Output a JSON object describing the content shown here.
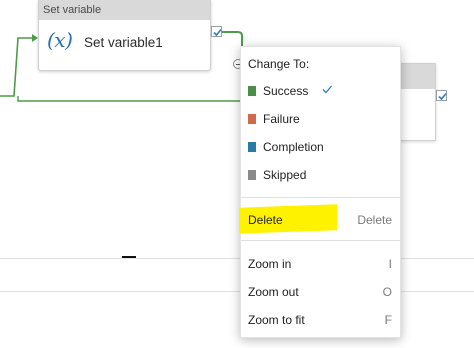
{
  "activity": {
    "type_label": "Set variable",
    "icon": "(x)",
    "name": "Set variable1"
  },
  "context_menu": {
    "title": "Change To:",
    "status_options": [
      {
        "label": "Success",
        "color": "#4e8c4a",
        "selected": true
      },
      {
        "label": "Failure",
        "color": "#d06a4c",
        "selected": false
      },
      {
        "label": "Completion",
        "color": "#2a7aa6",
        "selected": false
      },
      {
        "label": "Skipped",
        "color": "#8a8a8a",
        "selected": false
      }
    ],
    "delete": {
      "label": "Delete",
      "shortcut": "Delete",
      "highlight_color": "#fff200"
    },
    "zoom_actions": [
      {
        "label": "Zoom in",
        "shortcut": "I"
      },
      {
        "label": "Zoom out",
        "shortcut": "O"
      },
      {
        "label": "Zoom to fit",
        "shortcut": "F"
      }
    ]
  },
  "colors": {
    "connector_success": "#4e9a4a",
    "check_accent": "#2b7fc1",
    "header_gray": "#d9d9d9"
  }
}
